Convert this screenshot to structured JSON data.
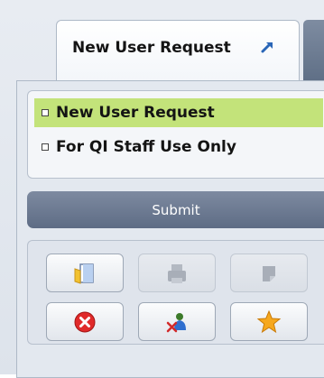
{
  "tab": {
    "label": "New User Request",
    "icon": "external-link-icon"
  },
  "list": {
    "items": [
      {
        "label": "New User Request",
        "active": true
      },
      {
        "label": "For QI Staff Use Only",
        "active": false
      }
    ]
  },
  "submit": {
    "label": "Submit"
  },
  "toolbar": {
    "buttons": [
      {
        "icon": "new-document-icon",
        "enabled": true
      },
      {
        "icon": "print-icon",
        "enabled": false
      },
      {
        "icon": "note-icon",
        "enabled": false
      },
      {
        "icon": "close-icon",
        "enabled": true
      },
      {
        "icon": "tools-icon",
        "enabled": true
      },
      {
        "icon": "favorite-star-icon",
        "enabled": true
      }
    ]
  },
  "colors": {
    "active_item": "#c3e37a",
    "submit_bg": "#6b798f",
    "close_red": "#e02a2a",
    "star_orange": "#f6a81e"
  }
}
